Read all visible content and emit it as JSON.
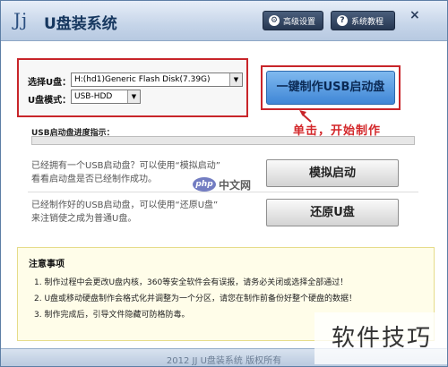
{
  "window": {
    "logo": "Jj",
    "title": "U盘装系统",
    "buttons": {
      "settings": "高级设置",
      "tutorial": "系统教程",
      "close": "×"
    }
  },
  "config": {
    "disk_label": "选择U盘：",
    "disk_value": "H:(hd1)Generic Flash Disk(7.39G)",
    "mode_label": "U盘模式：",
    "mode_value": "USB-HDD"
  },
  "make_button": {
    "label": "一键制作USB启动盘",
    "annotation": "单击，开始制作"
  },
  "usb_section": {
    "title": "USB启动盘进度指示：",
    "simulate": {
      "desc_line1": "已经拥有一个USB启动盘？可以使用“模拟启动”",
      "desc_line2": "看看启动盘是否已经制作成功。",
      "button": "模拟启动"
    },
    "restore": {
      "desc_line1": "已经制作好的USB启动盘，可以使用“还原U盘”",
      "desc_line2": "来注销使之成为普通U盘。",
      "button": "还原U盘"
    }
  },
  "notice": {
    "title": "注意事项",
    "items": [
      "1. 制作过程中会更改U盘内核，360等安全软件会有误报，请务必关闭或选择全部通过！",
      "2. U盘或移动硬盘制作会格式化并调整为一个分区，请您在制作前备份好整个硬盘的数据！",
      "3. 制作完成后，引导文件隐藏可防格防毒。"
    ]
  },
  "footer": {
    "text": "2012 JJ U盘装系统 版权所有"
  },
  "watermarks": {
    "php_badge": "php",
    "php_text": "中文网",
    "big_text": "软件技巧"
  },
  "colors": {
    "highlight_red": "#c8252a",
    "primary_blue": "#3f86d6",
    "title_bar": "#c6d5e9"
  }
}
